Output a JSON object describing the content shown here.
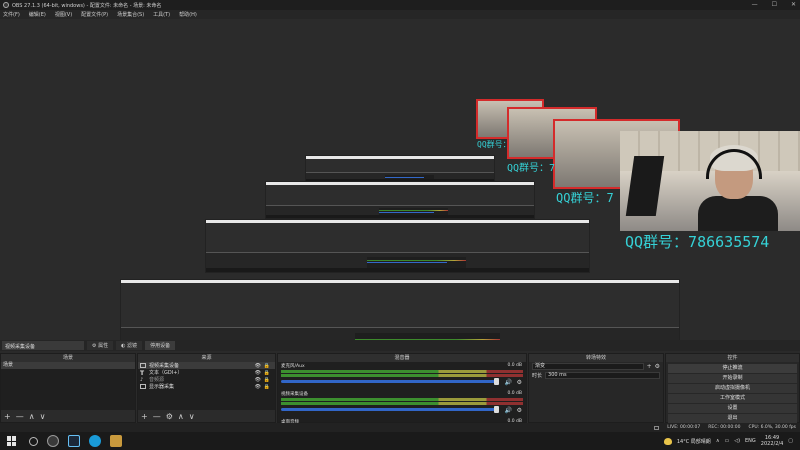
{
  "window": {
    "title": "OBS 27.1.3 (64-bit, windows) - 配置文件: 未命名 - 场景: 未命名",
    "min_glyph": "—",
    "max_glyph": "☐",
    "close_glyph": "✕"
  },
  "menubar": {
    "items": [
      "文件(F)",
      "编辑(E)",
      "视图(V)",
      "配置文件(P)",
      "场景集合(S)",
      "工具(T)",
      "帮助(H)"
    ]
  },
  "preview": {
    "watermark_text": "QQ群号：786635574",
    "watermark_partial_2": "QQ群号：7",
    "watermark_partial_3": "QQ群号：7",
    "watermark_partial_4": "QQ群号："
  },
  "scene_bar": {
    "current_scene": "视频采集设备",
    "properties_label": "属性",
    "filters_label": "滤镜",
    "deactivate_label": "停用设备"
  },
  "docks": {
    "scenes": {
      "title": "场景",
      "items": [
        "场景"
      ],
      "footer": [
        "+",
        "—",
        "∧",
        "∨"
      ]
    },
    "sources": {
      "title": "来源",
      "items": [
        "视频采集设备",
        "文本（GDI+）",
        "音频源",
        "显示器采集"
      ],
      "footer": [
        "+",
        "—",
        "⚙",
        "∧",
        "∨"
      ]
    },
    "mixer": {
      "title": "混音器",
      "channels": [
        {
          "name": "麦克风/Aux",
          "db": "0.0 dB"
        },
        {
          "name": "视频采集设备",
          "db": "0.0 dB"
        },
        {
          "name": "桌面音频",
          "db": "0.0 dB"
        }
      ]
    },
    "transitions": {
      "title": "转场特效",
      "selected": "渐变",
      "duration_label": "时长",
      "duration_value": "300 ms"
    },
    "controls": {
      "title": "控件",
      "buttons": [
        "停止推流",
        "开始录制",
        "启动虚拟摄像机",
        "工作室模式",
        "设置",
        "退出"
      ]
    }
  },
  "statusbar": {
    "live": "LIVE: 00:00:07",
    "rec": "REC: 00:00:00",
    "cpu": "CPU: 6.0%, 30.00 fps"
  },
  "taskbar": {
    "weather": "14°C 局部晴朗",
    "lang": "ENG",
    "time": "16:49",
    "date": "2022/2/4"
  }
}
